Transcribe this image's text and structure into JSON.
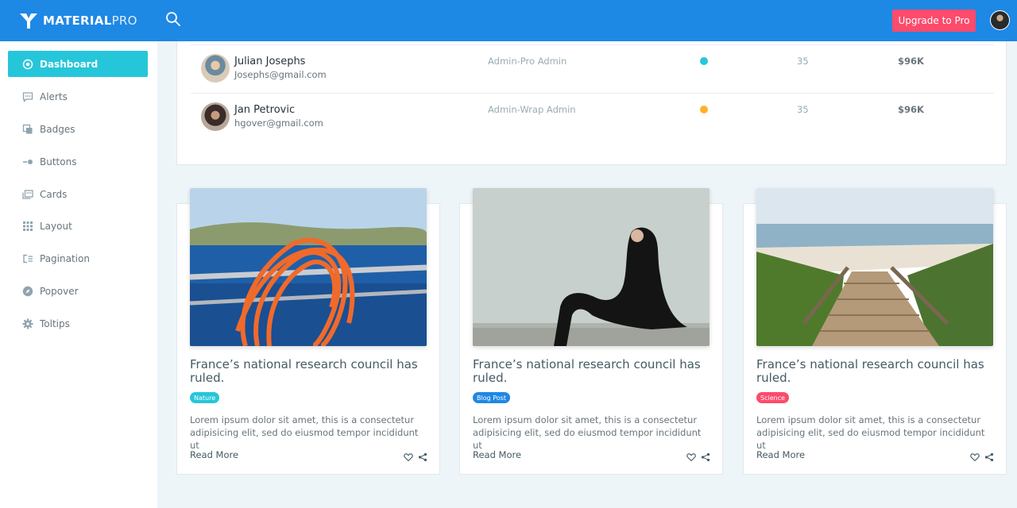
{
  "brand": {
    "bold": "MATERIAL",
    "light": "PRO"
  },
  "header": {
    "upgrade_label": "Upgrade to Pro"
  },
  "sidebar": {
    "items": [
      {
        "label": "Dashboard",
        "icon": "target-icon",
        "active": true
      },
      {
        "label": "Alerts",
        "icon": "chat-alert-icon"
      },
      {
        "label": "Badges",
        "icon": "badge-icon"
      },
      {
        "label": "Buttons",
        "icon": "toggle-button-icon"
      },
      {
        "label": "Cards",
        "icon": "cards-icon"
      },
      {
        "label": "Layout",
        "icon": "grid-icon"
      },
      {
        "label": "Pagination",
        "icon": "pagination-icon"
      },
      {
        "label": "Popover",
        "icon": "compass-icon"
      },
      {
        "label": "Toltips",
        "icon": "gear-icon"
      }
    ]
  },
  "table": {
    "rows": [
      {
        "name": "Julian Josephs",
        "email": "Josephs@gmail.com",
        "role": "Admin-Pro Admin",
        "status_color": "#26c6da",
        "count": "35",
        "amount": "$96K"
      },
      {
        "name": "Jan Petrovic",
        "email": "hgover@gmail.com",
        "role": "Admin-Wrap Admin",
        "status_color": "#ffb22b",
        "count": "35",
        "amount": "$96K"
      }
    ]
  },
  "blog": {
    "cards": [
      {
        "title": "France’s national research council has ruled.",
        "tag": "Nature",
        "tag_color": "#26c6da",
        "text": "Lorem ipsum dolor sit amet, this is a consectetur adipisicing elit, sed do eiusmod tempor incididunt ut",
        "read_more": "Read More",
        "image": "orange rope on boat railing by the sea"
      },
      {
        "title": "France’s national research council has ruled.",
        "tag": "Blog Post",
        "tag_color": "#1e88e5",
        "text": "Lorem ipsum dolor sit amet, this is a consectetur adipisicing elit, sed do eiusmod tempor incididunt ut",
        "read_more": "Read More",
        "image": "woman in black dress sitting on ledge"
      },
      {
        "title": "France’s national research council has ruled.",
        "tag": "Science",
        "tag_color": "#fc4b6c",
        "text": "Lorem ipsum dolor sit amet, this is a consectetur adipisicing elit, sed do eiusmod tempor incididunt ut",
        "read_more": "Read More",
        "image": "wooden boardwalk to the beach"
      }
    ]
  },
  "colors": {
    "primary": "#1e88e5",
    "accent": "#26c6da",
    "danger": "#fc4b6c",
    "warning": "#ffb22b"
  }
}
